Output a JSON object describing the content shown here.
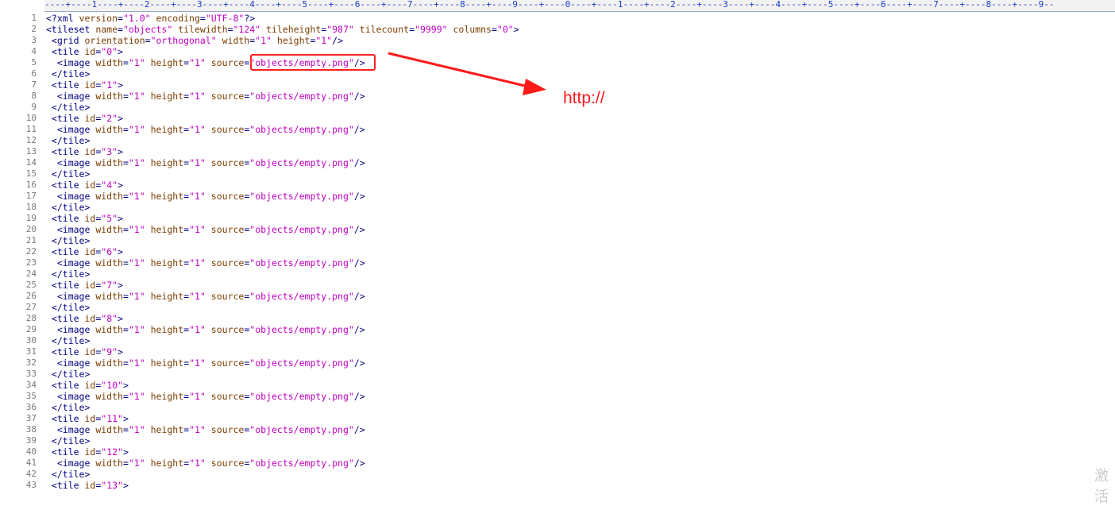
{
  "ruler": {
    "text": "----+----1----+----2----+----3----+----4----+----5----+----6----+----7----+----8----+----9----+----0----+----1----+----2----+----3----+----4----+----5----+----6----+----7----+----8----+----9--"
  },
  "lines": [
    {
      "n": "1",
      "parts": [
        [
          "t",
          "<?xml "
        ],
        [
          "a",
          "version"
        ],
        [
          "t",
          "="
        ],
        [
          "v",
          "\"1.0\""
        ],
        [
          "t",
          " "
        ],
        [
          "a",
          "encoding"
        ],
        [
          "t",
          "="
        ],
        [
          "v",
          "\"UTF-8\""
        ],
        [
          "t",
          "?>"
        ]
      ]
    },
    {
      "n": "2",
      "parts": [
        [
          "t",
          "<tileset "
        ],
        [
          "a",
          "name"
        ],
        [
          "t",
          "="
        ],
        [
          "v",
          "\"objects\""
        ],
        [
          "t",
          " "
        ],
        [
          "a",
          "tilewidth"
        ],
        [
          "t",
          "="
        ],
        [
          "v",
          "\"124\""
        ],
        [
          "t",
          " "
        ],
        [
          "a",
          "tileheight"
        ],
        [
          "t",
          "="
        ],
        [
          "v",
          "\"987\""
        ],
        [
          "t",
          " "
        ],
        [
          "a",
          "tilecount"
        ],
        [
          "t",
          "="
        ],
        [
          "v",
          "\"9999\""
        ],
        [
          "t",
          " "
        ],
        [
          "a",
          "columns"
        ],
        [
          "t",
          "="
        ],
        [
          "v",
          "\"0\""
        ],
        [
          "t",
          ">"
        ]
      ]
    },
    {
      "n": "3",
      "parts": [
        [
          "t",
          " <grid "
        ],
        [
          "a",
          "orientation"
        ],
        [
          "t",
          "="
        ],
        [
          "v",
          "\"orthogonal\""
        ],
        [
          "t",
          " "
        ],
        [
          "a",
          "width"
        ],
        [
          "t",
          "="
        ],
        [
          "v",
          "\"1\""
        ],
        [
          "t",
          " "
        ],
        [
          "a",
          "height"
        ],
        [
          "t",
          "="
        ],
        [
          "v",
          "\"1\""
        ],
        [
          "t",
          "/>"
        ]
      ]
    },
    {
      "n": "4",
      "parts": [
        [
          "t",
          " <tile "
        ],
        [
          "a",
          "id"
        ],
        [
          "t",
          "="
        ],
        [
          "v",
          "\"0\""
        ],
        [
          "t",
          ">"
        ]
      ]
    },
    {
      "n": "5",
      "parts": [
        [
          "t",
          "  <image "
        ],
        [
          "a",
          "width"
        ],
        [
          "t",
          "="
        ],
        [
          "v",
          "\"1\""
        ],
        [
          "t",
          " "
        ],
        [
          "a",
          "height"
        ],
        [
          "t",
          "="
        ],
        [
          "v",
          "\"1\""
        ],
        [
          "t",
          " "
        ],
        [
          "a",
          "source"
        ],
        [
          "t",
          "="
        ],
        [
          "v",
          "\"objects/empty.png\""
        ],
        [
          "t",
          "/>"
        ]
      ]
    },
    {
      "n": "6",
      "parts": [
        [
          "t",
          " </tile>"
        ]
      ]
    },
    {
      "n": "7",
      "parts": [
        [
          "t",
          " <tile "
        ],
        [
          "a",
          "id"
        ],
        [
          "t",
          "="
        ],
        [
          "v",
          "\"1\""
        ],
        [
          "t",
          ">"
        ]
      ]
    },
    {
      "n": "8",
      "parts": [
        [
          "t",
          "  <image "
        ],
        [
          "a",
          "width"
        ],
        [
          "t",
          "="
        ],
        [
          "v",
          "\"1\""
        ],
        [
          "t",
          " "
        ],
        [
          "a",
          "height"
        ],
        [
          "t",
          "="
        ],
        [
          "v",
          "\"1\""
        ],
        [
          "t",
          " "
        ],
        [
          "a",
          "source"
        ],
        [
          "t",
          "="
        ],
        [
          "v",
          "\"objects/empty.png\""
        ],
        [
          "t",
          "/>"
        ]
      ]
    },
    {
      "n": "9",
      "parts": [
        [
          "t",
          " </tile>"
        ]
      ]
    },
    {
      "n": "10",
      "parts": [
        [
          "t",
          " <tile "
        ],
        [
          "a",
          "id"
        ],
        [
          "t",
          "="
        ],
        [
          "v",
          "\"2\""
        ],
        [
          "t",
          ">"
        ]
      ]
    },
    {
      "n": "11",
      "parts": [
        [
          "t",
          "  <image "
        ],
        [
          "a",
          "width"
        ],
        [
          "t",
          "="
        ],
        [
          "v",
          "\"1\""
        ],
        [
          "t",
          " "
        ],
        [
          "a",
          "height"
        ],
        [
          "t",
          "="
        ],
        [
          "v",
          "\"1\""
        ],
        [
          "t",
          " "
        ],
        [
          "a",
          "source"
        ],
        [
          "t",
          "="
        ],
        [
          "v",
          "\"objects/empty.png\""
        ],
        [
          "t",
          "/>"
        ]
      ]
    },
    {
      "n": "12",
      "parts": [
        [
          "t",
          " </tile>"
        ]
      ]
    },
    {
      "n": "13",
      "parts": [
        [
          "t",
          " <tile "
        ],
        [
          "a",
          "id"
        ],
        [
          "t",
          "="
        ],
        [
          "v",
          "\"3\""
        ],
        [
          "t",
          ">"
        ]
      ]
    },
    {
      "n": "14",
      "parts": [
        [
          "t",
          "  <image "
        ],
        [
          "a",
          "width"
        ],
        [
          "t",
          "="
        ],
        [
          "v",
          "\"1\""
        ],
        [
          "t",
          " "
        ],
        [
          "a",
          "height"
        ],
        [
          "t",
          "="
        ],
        [
          "v",
          "\"1\""
        ],
        [
          "t",
          " "
        ],
        [
          "a",
          "source"
        ],
        [
          "t",
          "="
        ],
        [
          "v",
          "\"objects/empty.png\""
        ],
        [
          "t",
          "/>"
        ]
      ]
    },
    {
      "n": "15",
      "parts": [
        [
          "t",
          " </tile>"
        ]
      ]
    },
    {
      "n": "16",
      "parts": [
        [
          "t",
          " <tile "
        ],
        [
          "a",
          "id"
        ],
        [
          "t",
          "="
        ],
        [
          "v",
          "\"4\""
        ],
        [
          "t",
          ">"
        ]
      ]
    },
    {
      "n": "17",
      "parts": [
        [
          "t",
          "  <image "
        ],
        [
          "a",
          "width"
        ],
        [
          "t",
          "="
        ],
        [
          "v",
          "\"1\""
        ],
        [
          "t",
          " "
        ],
        [
          "a",
          "height"
        ],
        [
          "t",
          "="
        ],
        [
          "v",
          "\"1\""
        ],
        [
          "t",
          " "
        ],
        [
          "a",
          "source"
        ],
        [
          "t",
          "="
        ],
        [
          "v",
          "\"objects/empty.png\""
        ],
        [
          "t",
          "/>"
        ]
      ]
    },
    {
      "n": "18",
      "parts": [
        [
          "t",
          " </tile>"
        ]
      ]
    },
    {
      "n": "19",
      "parts": [
        [
          "t",
          " <tile "
        ],
        [
          "a",
          "id"
        ],
        [
          "t",
          "="
        ],
        [
          "v",
          "\"5\""
        ],
        [
          "t",
          ">"
        ]
      ]
    },
    {
      "n": "20",
      "parts": [
        [
          "t",
          "  <image "
        ],
        [
          "a",
          "width"
        ],
        [
          "t",
          "="
        ],
        [
          "v",
          "\"1\""
        ],
        [
          "t",
          " "
        ],
        [
          "a",
          "height"
        ],
        [
          "t",
          "="
        ],
        [
          "v",
          "\"1\""
        ],
        [
          "t",
          " "
        ],
        [
          "a",
          "source"
        ],
        [
          "t",
          "="
        ],
        [
          "v",
          "\"objects/empty.png\""
        ],
        [
          "t",
          "/>"
        ]
      ]
    },
    {
      "n": "21",
      "parts": [
        [
          "t",
          " </tile>"
        ]
      ]
    },
    {
      "n": "22",
      "parts": [
        [
          "t",
          " <tile "
        ],
        [
          "a",
          "id"
        ],
        [
          "t",
          "="
        ],
        [
          "v",
          "\"6\""
        ],
        [
          "t",
          ">"
        ]
      ]
    },
    {
      "n": "23",
      "parts": [
        [
          "t",
          "  <image "
        ],
        [
          "a",
          "width"
        ],
        [
          "t",
          "="
        ],
        [
          "v",
          "\"1\""
        ],
        [
          "t",
          " "
        ],
        [
          "a",
          "height"
        ],
        [
          "t",
          "="
        ],
        [
          "v",
          "\"1\""
        ],
        [
          "t",
          " "
        ],
        [
          "a",
          "source"
        ],
        [
          "t",
          "="
        ],
        [
          "v",
          "\"objects/empty.png\""
        ],
        [
          "t",
          "/>"
        ]
      ]
    },
    {
      "n": "24",
      "parts": [
        [
          "t",
          " </tile>"
        ]
      ]
    },
    {
      "n": "25",
      "parts": [
        [
          "t",
          " <tile "
        ],
        [
          "a",
          "id"
        ],
        [
          "t",
          "="
        ],
        [
          "v",
          "\"7\""
        ],
        [
          "t",
          ">"
        ]
      ]
    },
    {
      "n": "26",
      "parts": [
        [
          "t",
          "  <image "
        ],
        [
          "a",
          "width"
        ],
        [
          "t",
          "="
        ],
        [
          "v",
          "\"1\""
        ],
        [
          "t",
          " "
        ],
        [
          "a",
          "height"
        ],
        [
          "t",
          "="
        ],
        [
          "v",
          "\"1\""
        ],
        [
          "t",
          " "
        ],
        [
          "a",
          "source"
        ],
        [
          "t",
          "="
        ],
        [
          "v",
          "\"objects/empty.png\""
        ],
        [
          "t",
          "/>"
        ]
      ]
    },
    {
      "n": "27",
      "parts": [
        [
          "t",
          " </tile>"
        ]
      ]
    },
    {
      "n": "28",
      "parts": [
        [
          "t",
          " <tile "
        ],
        [
          "a",
          "id"
        ],
        [
          "t",
          "="
        ],
        [
          "v",
          "\"8\""
        ],
        [
          "t",
          ">"
        ]
      ]
    },
    {
      "n": "29",
      "parts": [
        [
          "t",
          "  <image "
        ],
        [
          "a",
          "width"
        ],
        [
          "t",
          "="
        ],
        [
          "v",
          "\"1\""
        ],
        [
          "t",
          " "
        ],
        [
          "a",
          "height"
        ],
        [
          "t",
          "="
        ],
        [
          "v",
          "\"1\""
        ],
        [
          "t",
          " "
        ],
        [
          "a",
          "source"
        ],
        [
          "t",
          "="
        ],
        [
          "v",
          "\"objects/empty.png\""
        ],
        [
          "t",
          "/>"
        ]
      ]
    },
    {
      "n": "30",
      "parts": [
        [
          "t",
          " </tile>"
        ]
      ]
    },
    {
      "n": "31",
      "parts": [
        [
          "t",
          " <tile "
        ],
        [
          "a",
          "id"
        ],
        [
          "t",
          "="
        ],
        [
          "v",
          "\"9\""
        ],
        [
          "t",
          ">"
        ]
      ]
    },
    {
      "n": "32",
      "parts": [
        [
          "t",
          "  <image "
        ],
        [
          "a",
          "width"
        ],
        [
          "t",
          "="
        ],
        [
          "v",
          "\"1\""
        ],
        [
          "t",
          " "
        ],
        [
          "a",
          "height"
        ],
        [
          "t",
          "="
        ],
        [
          "v",
          "\"1\""
        ],
        [
          "t",
          " "
        ],
        [
          "a",
          "source"
        ],
        [
          "t",
          "="
        ],
        [
          "v",
          "\"objects/empty.png\""
        ],
        [
          "t",
          "/>"
        ]
      ]
    },
    {
      "n": "33",
      "parts": [
        [
          "t",
          " </tile>"
        ]
      ]
    },
    {
      "n": "34",
      "parts": [
        [
          "t",
          " <tile "
        ],
        [
          "a",
          "id"
        ],
        [
          "t",
          "="
        ],
        [
          "v",
          "\"10\""
        ],
        [
          "t",
          ">"
        ]
      ]
    },
    {
      "n": "35",
      "parts": [
        [
          "t",
          "  <image "
        ],
        [
          "a",
          "width"
        ],
        [
          "t",
          "="
        ],
        [
          "v",
          "\"1\""
        ],
        [
          "t",
          " "
        ],
        [
          "a",
          "height"
        ],
        [
          "t",
          "="
        ],
        [
          "v",
          "\"1\""
        ],
        [
          "t",
          " "
        ],
        [
          "a",
          "source"
        ],
        [
          "t",
          "="
        ],
        [
          "v",
          "\"objects/empty.png\""
        ],
        [
          "t",
          "/>"
        ]
      ]
    },
    {
      "n": "36",
      "parts": [
        [
          "t",
          " </tile>"
        ]
      ]
    },
    {
      "n": "37",
      "parts": [
        [
          "t",
          " <tile "
        ],
        [
          "a",
          "id"
        ],
        [
          "t",
          "="
        ],
        [
          "v",
          "\"11\""
        ],
        [
          "t",
          ">"
        ]
      ]
    },
    {
      "n": "38",
      "parts": [
        [
          "t",
          "  <image "
        ],
        [
          "a",
          "width"
        ],
        [
          "t",
          "="
        ],
        [
          "v",
          "\"1\""
        ],
        [
          "t",
          " "
        ],
        [
          "a",
          "height"
        ],
        [
          "t",
          "="
        ],
        [
          "v",
          "\"1\""
        ],
        [
          "t",
          " "
        ],
        [
          "a",
          "source"
        ],
        [
          "t",
          "="
        ],
        [
          "v",
          "\"objects/empty.png\""
        ],
        [
          "t",
          "/>"
        ]
      ]
    },
    {
      "n": "39",
      "parts": [
        [
          "t",
          " </tile>"
        ]
      ]
    },
    {
      "n": "40",
      "parts": [
        [
          "t",
          " <tile "
        ],
        [
          "a",
          "id"
        ],
        [
          "t",
          "="
        ],
        [
          "v",
          "\"12\""
        ],
        [
          "t",
          ">"
        ]
      ]
    },
    {
      "n": "41",
      "parts": [
        [
          "t",
          "  <image "
        ],
        [
          "a",
          "width"
        ],
        [
          "t",
          "="
        ],
        [
          "v",
          "\"1\""
        ],
        [
          "t",
          " "
        ],
        [
          "a",
          "height"
        ],
        [
          "t",
          "="
        ],
        [
          "v",
          "\"1\""
        ],
        [
          "t",
          " "
        ],
        [
          "a",
          "source"
        ],
        [
          "t",
          "="
        ],
        [
          "v",
          "\"objects/empty.png\""
        ],
        [
          "t",
          "/>"
        ]
      ]
    },
    {
      "n": "42",
      "parts": [
        [
          "t",
          " </tile>"
        ]
      ]
    },
    {
      "n": "43",
      "parts": [
        [
          "t",
          " <tile "
        ],
        [
          "a",
          "id"
        ],
        [
          "t",
          "="
        ],
        [
          "v",
          "\"13\""
        ],
        [
          "t",
          ">"
        ]
      ]
    }
  ],
  "annotation": {
    "text": "http://",
    "color": "#ff1a1a"
  },
  "watermark": "激活"
}
